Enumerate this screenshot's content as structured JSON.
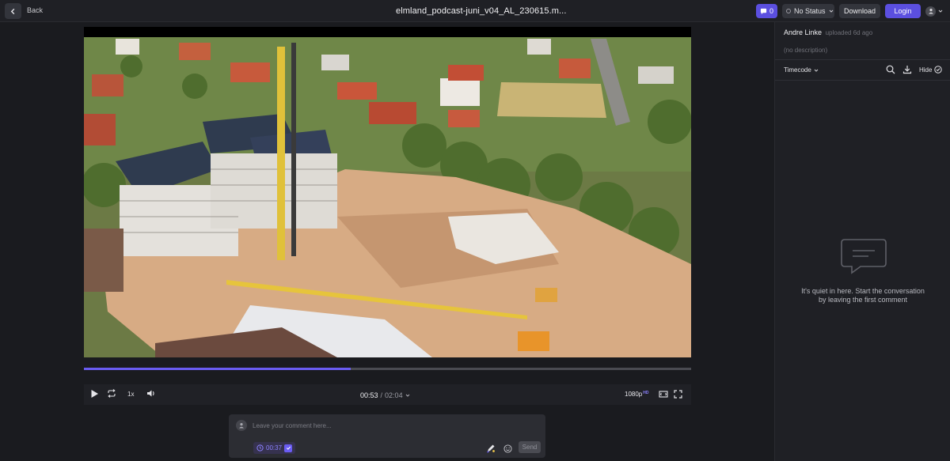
{
  "header": {
    "back_label": "Back",
    "file_title": "elmland_podcast-juni_v04_AL_230615.m...",
    "comment_count": "0",
    "status_label": "No Status",
    "download_label": "Download",
    "login_label": "Login"
  },
  "player": {
    "current_time": "00:53",
    "separator": "/",
    "duration": "02:04",
    "speed": "1x",
    "quality": "1080p",
    "quality_badge": "HD",
    "progress_fraction": 0.44,
    "buffered_fraction": 0.44
  },
  "composer": {
    "placeholder": "Leave your comment here...",
    "timecode": "00:37",
    "send_label": "Send"
  },
  "sidebar": {
    "uploader_name": "Andre Linke",
    "uploader_meta": "uploaded 6d ago",
    "description": "(no description)",
    "filter_label": "Timecode",
    "hide_label": "Hide",
    "empty_line1": "It's quiet in here. Start the conversation",
    "empty_line2": "by leaving the first comment"
  },
  "colors": {
    "accent": "#5b4fe0",
    "background": "#1a1b1f",
    "panel": "#1f2025"
  },
  "icons": [
    "chevron-left-icon",
    "comment-bubble-icon",
    "chevron-down-icon",
    "user-icon",
    "play-icon",
    "loop-icon",
    "volume-icon",
    "theater-mode-icon",
    "fullscreen-icon",
    "clock-icon",
    "checkbox-icon",
    "pen-icon",
    "emoji-icon",
    "search-icon",
    "download-icon",
    "check-circle-icon",
    "empty-chat-icon"
  ]
}
